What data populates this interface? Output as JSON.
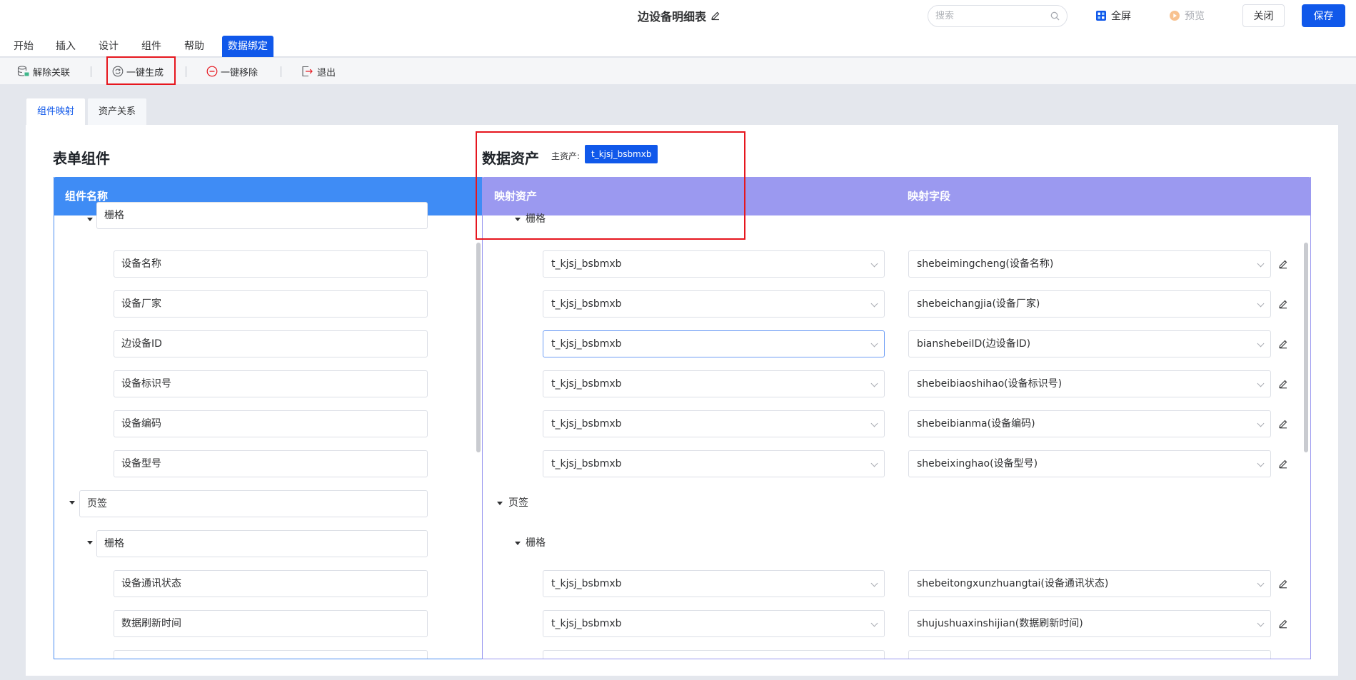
{
  "header": {
    "title": "边设备明细表",
    "search_placeholder": "搜索",
    "fullscreen_label": "全屏",
    "preview_label": "预览",
    "close_label": "关闭",
    "save_label": "保存"
  },
  "menu": {
    "items": [
      "开始",
      "插入",
      "设计",
      "组件",
      "帮助",
      "数据绑定"
    ],
    "active": "数据绑定"
  },
  "toolbar": {
    "unlink_label": "解除关联",
    "generate_label": "一键生成",
    "remove_label": "一键移除",
    "exit_label": "退出"
  },
  "tabs": {
    "component_mapping": "组件映射",
    "asset_relation": "资产关系"
  },
  "left": {
    "title": "表单组件",
    "column_header": "组件名称",
    "rows": [
      {
        "type": "group",
        "label": "栅格"
      },
      {
        "type": "field",
        "label": "设备名称"
      },
      {
        "type": "field",
        "label": "设备厂家"
      },
      {
        "type": "field",
        "label": "边设备ID"
      },
      {
        "type": "field",
        "label": "设备标识号"
      },
      {
        "type": "field",
        "label": "设备编码"
      },
      {
        "type": "field",
        "label": "设备型号"
      },
      {
        "type": "group",
        "label": "页签"
      },
      {
        "type": "group",
        "label": "栅格"
      },
      {
        "type": "field",
        "label": "设备通讯状态"
      },
      {
        "type": "field",
        "label": "数据刷新时间"
      }
    ]
  },
  "right": {
    "title": "数据资产",
    "main_asset_label": "主资产:",
    "main_asset_value": "t_kjsj_bsbmxb",
    "col_asset": "映射资产",
    "col_field": "映射字段",
    "group_grid": "栅格",
    "group_tab": "页签",
    "group_grid2": "栅格",
    "rows": [
      {
        "asset": "t_kjsj_bsbmxb",
        "field": "shebeimingcheng(设备名称)"
      },
      {
        "asset": "t_kjsj_bsbmxb",
        "field": "shebeichangjia(设备厂家)"
      },
      {
        "asset": "t_kjsj_bsbmxb",
        "field": "bianshebeiID(边设备ID)"
      },
      {
        "asset": "t_kjsj_bsbmxb",
        "field": "shebeibiaoshihao(设备标识号)"
      },
      {
        "asset": "t_kjsj_bsbmxb",
        "field": "shebeibianma(设备编码)"
      },
      {
        "asset": "t_kjsj_bsbmxb",
        "field": "shebeixinghao(设备型号)"
      },
      {
        "asset": "t_kjsj_bsbmxb",
        "field": "shebeitongxunzhuangtai(设备通讯状态)"
      },
      {
        "asset": "t_kjsj_bsbmxb",
        "field": "shujushuaxinshijian(数据刷新时间)"
      }
    ]
  },
  "colors": {
    "primary": "#1058ea",
    "left_header": "#3f8cf5",
    "right_header": "#9b99f0",
    "highlight": "#e6161e"
  }
}
